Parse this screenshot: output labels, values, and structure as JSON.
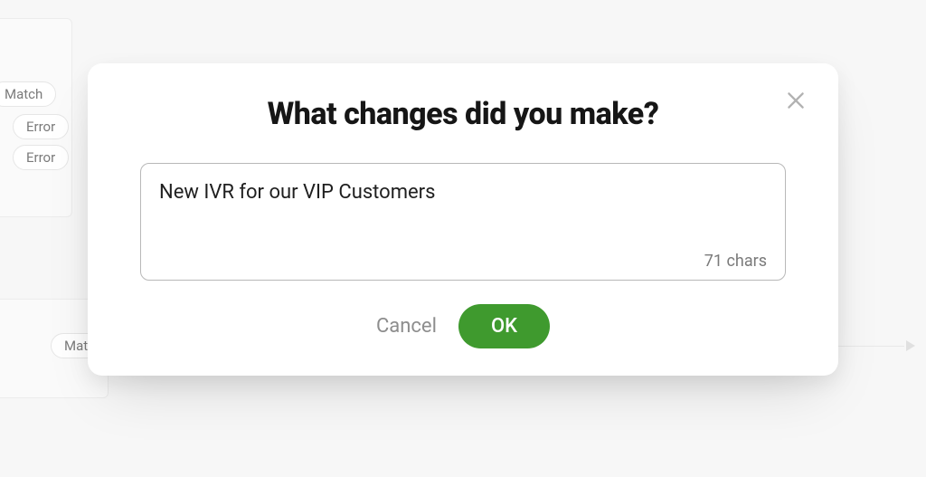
{
  "background": {
    "node_labels": {
      "match_top": "Match",
      "error_1": "Error",
      "error_2": "Error",
      "mat_partial": "Mat"
    }
  },
  "modal": {
    "title": "What changes did you make?",
    "input_value": "New IVR for our VIP Customers",
    "char_counter": "71 chars",
    "cancel_label": "Cancel",
    "ok_label": "OK",
    "close_label": "Close"
  }
}
